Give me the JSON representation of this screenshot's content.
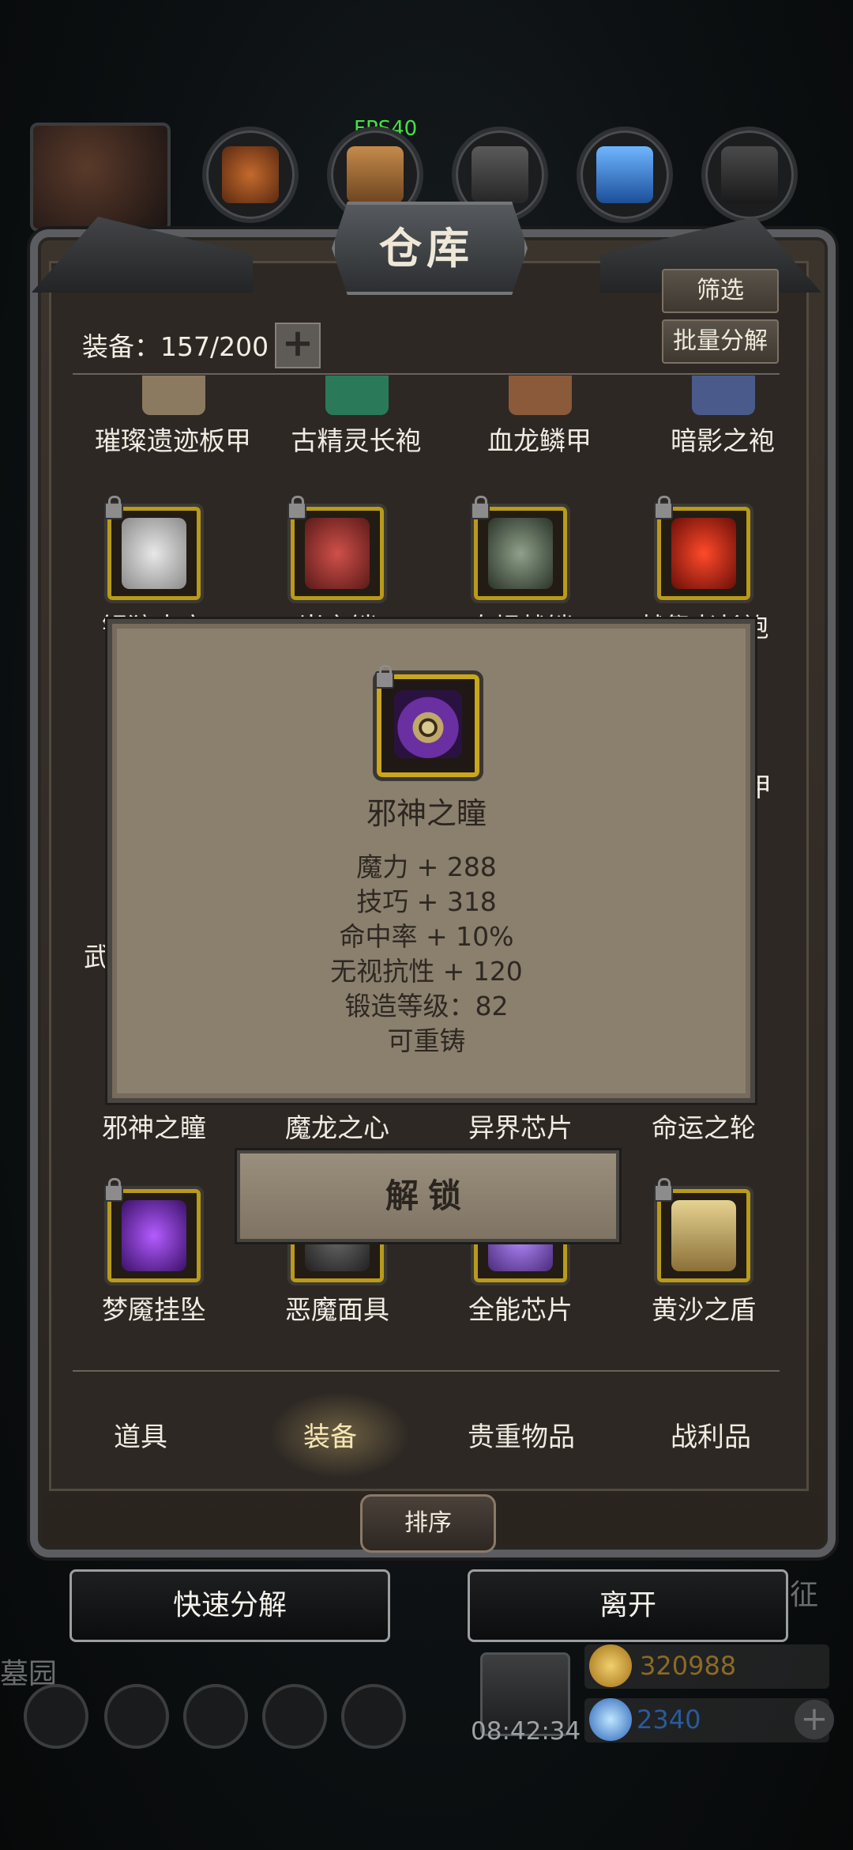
{
  "hud": {
    "fps": "FPS40"
  },
  "window": {
    "title": "仓库",
    "filter_label": "筛选",
    "batch_label": "批量分解"
  },
  "inventory": {
    "label": "装备：157/200",
    "expand": "+"
  },
  "grid": {
    "row1": [
      "璀璨遗迹板甲",
      "古精灵长袍",
      "血龙鳞甲",
      "暗影之袍"
    ],
    "row2": [
      "银狼大衣",
      "岚之铠",
      "泰坦战铠",
      "献祭者长袍"
    ],
    "row_partial": [
      "武",
      "甲"
    ],
    "row4": [
      "邪神之瞳",
      "魔龙之心",
      "异界芯片",
      "命运之轮"
    ],
    "row5": [
      "梦魇挂坠",
      "恶魔面具",
      "全能芯片",
      "黄沙之盾"
    ]
  },
  "tooltip": {
    "name": "邪神之瞳",
    "stats": [
      "魔力 + 288",
      "技巧 + 318",
      "命中率 + 10%",
      "无视抗性 + 120",
      "锻造等级：82",
      "可重铸"
    ]
  },
  "unlock_label": "解锁",
  "tabs": [
    "道具",
    "装备",
    "贵重物品",
    "战利品"
  ],
  "active_tab": "装备",
  "sort_label": "排序",
  "quick_decompose": "快速分解",
  "leave": "离开",
  "background": {
    "left_text": "墓园",
    "right_text": "征"
  },
  "resources": {
    "gold": "320988",
    "gems": "2340"
  },
  "clock": "08:42:34",
  "colors": {
    "frame_gold": "#c9a61c",
    "tooltip_bg": "#8b7f6e",
    "fps_green": "#46e046"
  }
}
